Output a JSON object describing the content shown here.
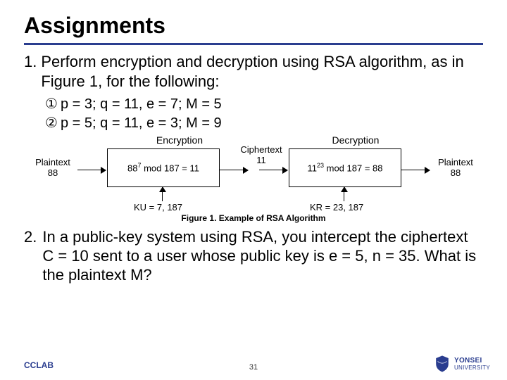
{
  "title": "Assignments",
  "q1": {
    "number": "1.",
    "text": "Perform encryption and decryption using RSA algorithm, as in Figure 1, for the following:",
    "items": [
      {
        "marker": "①",
        "text": "p = 3; q = 11, e = 7; M = 5"
      },
      {
        "marker": "②",
        "text": "p = 5; q = 11, e = 3; M = 9"
      }
    ]
  },
  "figure": {
    "encryption_head": "Encryption",
    "decryption_head": "Decryption",
    "plaintext_in_label": "Plaintext",
    "plaintext_in_value": "88",
    "enc_expr_pre": "88",
    "enc_expr_sup": "7",
    "enc_expr_post": " mod 187 = 11",
    "cipher_label": "Ciphertext",
    "cipher_value": "11",
    "dec_expr_pre": "11",
    "dec_expr_sup": "23",
    "dec_expr_post": " mod 187 = 88",
    "plaintext_out_label": "Plaintext",
    "plaintext_out_value": "88",
    "ku_label": "KU = 7, 187",
    "kr_label": "KR = 23, 187",
    "caption": "Figure 1. Example of RSA Algorithm"
  },
  "q2": {
    "number": "2.",
    "text": "In a public-key system using RSA, you intercept the ciphertext C = 10 sent to a user whose public key is e = 5, n = 35. What is the plaintext M?"
  },
  "footer": {
    "brand": "CCLAB",
    "page": "31",
    "uni_line1": "YONSEI",
    "uni_line2": "UNIVERSITY"
  }
}
